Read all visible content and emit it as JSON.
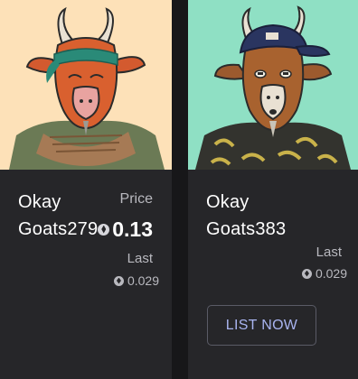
{
  "cards": [
    {
      "name_line1": "Okay",
      "name_line2": "Goats279",
      "art_icon": "goat-avatar-headband",
      "background_color": "#fde1b8",
      "price_label": "Price",
      "price_value": "0.13",
      "last_label": "Last",
      "last_value": "0.029"
    },
    {
      "name_line1": "Okay",
      "name_line2": "Goats383",
      "art_icon": "goat-avatar-cap",
      "background_color": "#8fe0c4",
      "last_label": "Last",
      "last_value": "0.029",
      "list_button_label": "LIST NOW"
    }
  ],
  "colors": {
    "card_bg": "#262629",
    "muted_text": "#b9b9bf",
    "button_text": "#a9b4f0"
  }
}
